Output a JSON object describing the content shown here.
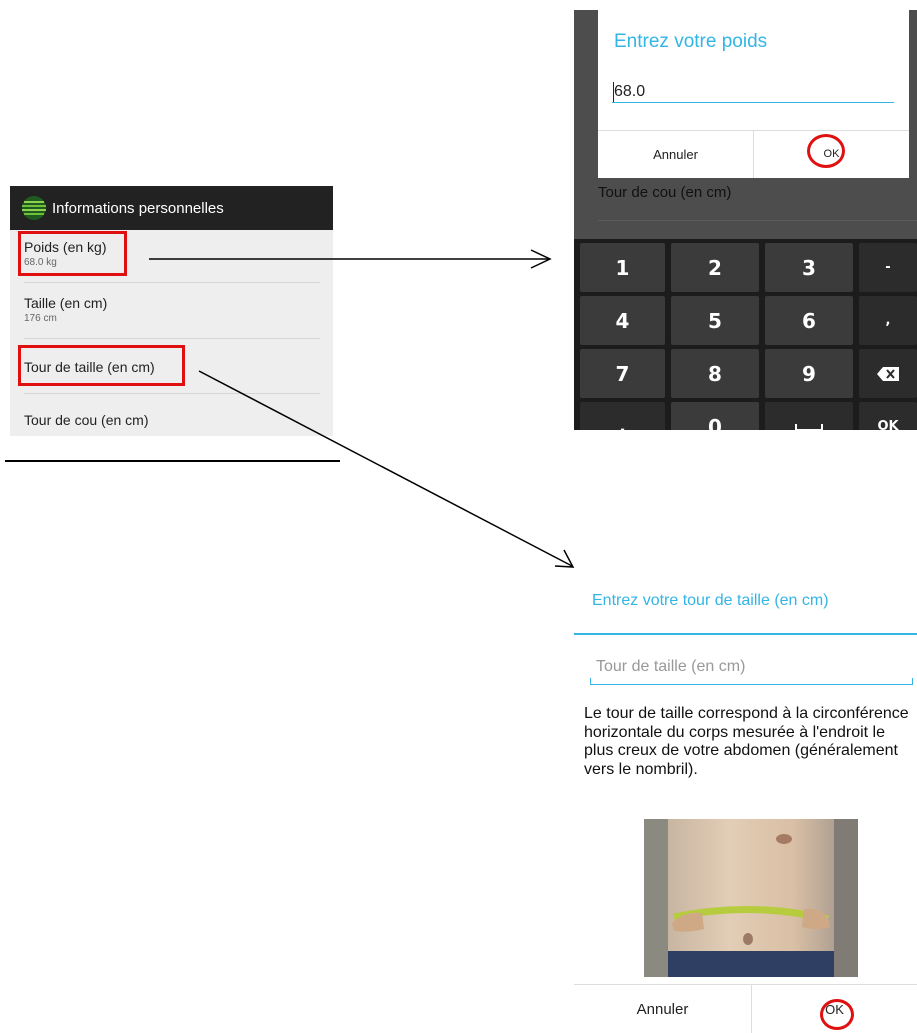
{
  "settings": {
    "header_title": "Informations personnelles",
    "items": [
      {
        "title": "Poids (en kg)",
        "summary": "68.0 kg"
      },
      {
        "title": "Taille (en cm)",
        "summary": "176 cm"
      },
      {
        "title": "Tour de taille (en cm)",
        "summary": ""
      },
      {
        "title": "Tour de cou (en cm)",
        "summary": ""
      }
    ],
    "icon": "app-logo-icon"
  },
  "weight_dialog": {
    "title": "Entrez votre poids",
    "value": "68.0",
    "cancel_label": "Annuler",
    "ok_label": "OK",
    "behind_item": "Tour de cou (en cm)"
  },
  "keypad": {
    "rows": [
      [
        "1",
        "2",
        "3",
        "-"
      ],
      [
        "4",
        "5",
        "6",
        ","
      ],
      [
        "7",
        "8",
        "9",
        "⌫"
      ],
      [
        ".",
        "0",
        "␣",
        "OK"
      ]
    ],
    "icons": {
      "backspace": "backspace-icon",
      "space": "space-bar-icon"
    }
  },
  "waist_dialog": {
    "title": "Entrez votre tour de taille (en cm)",
    "placeholder": "Tour de taille (en cm)",
    "help_text": "Le tour de taille correspond à la circonférence horizontale du corps mesurée à l'endroit le plus creux de votre abdomen (généralement vers le nombril).",
    "cancel_label": "Annuler",
    "ok_label": "OK",
    "image": "waist-measurement-photo"
  },
  "colors": {
    "accent": "#33b5e5",
    "highlight": "#e01010",
    "header_bg": "#222222",
    "keyboard_bg": "#1c1c1c"
  }
}
